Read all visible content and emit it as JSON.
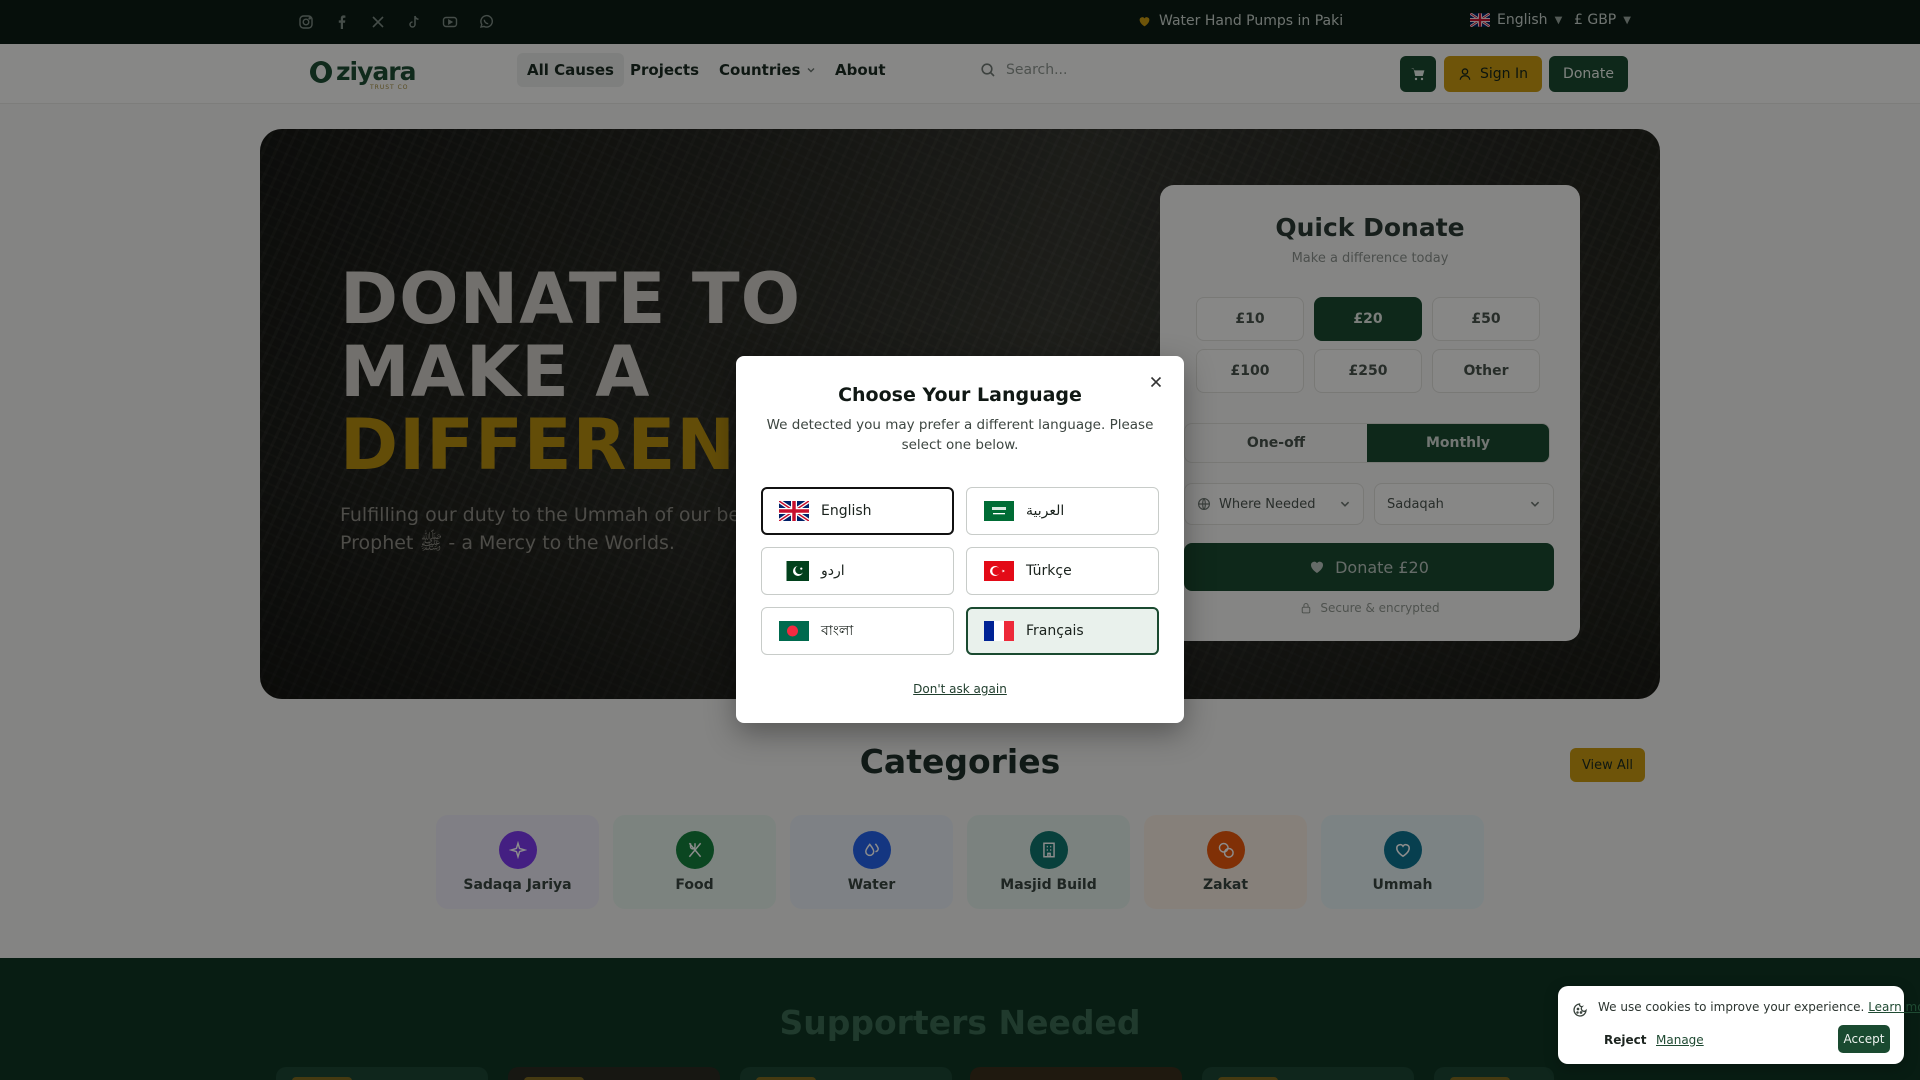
{
  "topbar": {
    "social": [
      "instagram-icon",
      "facebook-icon",
      "x-icon",
      "tiktok-icon",
      "youtube-icon",
      "whatsapp-icon"
    ],
    "announcement": "Water Hand Pumps in Paki",
    "language": "English",
    "currency": "£ GBP"
  },
  "header": {
    "logo": "ziyara",
    "logo_sub": "TRUST CO",
    "nav": [
      "All Causes",
      "Projects",
      "Countries",
      "About"
    ],
    "search_placeholder": "Search...",
    "signin": "Sign In",
    "donate": "Donate"
  },
  "hero": {
    "line1": "DONATE TO",
    "line2": "MAKE A",
    "line3": "DIFFERENC",
    "sub1": "Fulfilling our duty to the Ummah of our belove",
    "sub2": "Prophet ﷺ - a Mercy to the Worlds."
  },
  "quick_donate": {
    "title": "Quick Donate",
    "subtitle": "Make a difference today",
    "amounts": [
      "£10",
      "£20",
      "£50",
      "£100",
      "£250",
      "Other"
    ],
    "selected_amount": "£20",
    "frequency": [
      "One-off",
      "Monthly"
    ],
    "selected_frequency": "Monthly",
    "cause": "Where Needed",
    "type": "Sadaqah",
    "button": "Donate £20",
    "secure": "Secure & encrypted"
  },
  "categories": {
    "title": "Categories",
    "view_all": "View All",
    "items": [
      {
        "label": "Sadaqa Jariya",
        "icon": "sparkle-icon",
        "bg": "#e9e7f3",
        "color": "#7c3aed"
      },
      {
        "label": "Food",
        "icon": "utensils-icon",
        "bg": "#e2eee7",
        "color": "#15803d"
      },
      {
        "label": "Water",
        "icon": "droplets-icon",
        "bg": "#e5ebf2",
        "color": "#2563eb"
      },
      {
        "label": "Masjid Build",
        "icon": "building-icon",
        "bg": "#e1ede8",
        "color": "#0f766e"
      },
      {
        "label": "Zakat",
        "icon": "coins-icon",
        "bg": "#f4eadf",
        "color": "#ea580c"
      },
      {
        "label": "Ummah",
        "icon": "heart-icon",
        "bg": "#e2eef0",
        "color": "#0e7490"
      }
    ]
  },
  "supporters": {
    "title": "Supporters Needed"
  },
  "language_modal": {
    "title": "Choose Your Language",
    "description": "We detected you may prefer a different language. Please select one below.",
    "options": [
      {
        "label": "English",
        "flag": "uk"
      },
      {
        "label": "العربية",
        "flag": "sa"
      },
      {
        "label": "اردو",
        "flag": "pk"
      },
      {
        "label": "Türkçe",
        "flag": "tr"
      },
      {
        "label": "বাংলা",
        "flag": "bd"
      },
      {
        "label": "Français",
        "flag": "fr"
      }
    ],
    "current": "English",
    "suggested": "Français",
    "dont_ask": "Don't ask again"
  },
  "cookie": {
    "text": "We use cookies to improve your experience.",
    "learn_more": "Learn more",
    "reject": "Reject",
    "manage": "Manage",
    "accept": "Accept"
  },
  "colors": {
    "primary": "#1a4a30",
    "accent": "#c99a12",
    "topbar": "#0b1d15"
  }
}
